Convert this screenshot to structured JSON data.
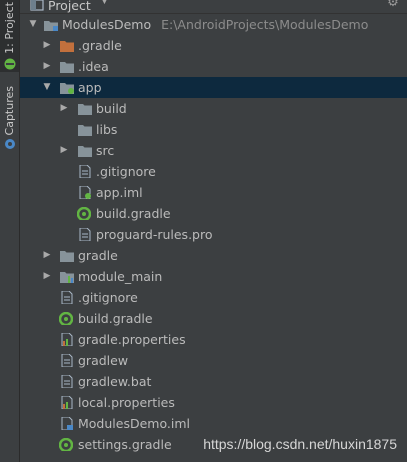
{
  "sidebar": {
    "project_tab": "1: Project",
    "captures_tab": "Captures"
  },
  "header": {
    "title": "Project"
  },
  "tree": {
    "root_name": "ModulesDemo",
    "root_path": "E:\\AndroidProjects\\ModulesDemo",
    "items": [
      {
        "label": ".gradle"
      },
      {
        "label": ".idea"
      },
      {
        "label": "app"
      },
      {
        "label": "build"
      },
      {
        "label": "libs"
      },
      {
        "label": "src"
      },
      {
        "label": ".gitignore"
      },
      {
        "label": "app.iml"
      },
      {
        "label": "build.gradle"
      },
      {
        "label": "proguard-rules.pro"
      },
      {
        "label": "gradle"
      },
      {
        "label": "module_main"
      },
      {
        "label": ".gitignore"
      },
      {
        "label": "build.gradle"
      },
      {
        "label": "gradle.properties"
      },
      {
        "label": "gradlew"
      },
      {
        "label": "gradlew.bat"
      },
      {
        "label": "local.properties"
      },
      {
        "label": "ModulesDemo.iml"
      },
      {
        "label": "settings.gradle"
      }
    ]
  },
  "watermark": "https://blog.csdn.net/huxin1875",
  "colors": {
    "background": "#3c3f41",
    "selection": "#0d293e",
    "folder": "#87939a",
    "gradle_folder": "#c2703d",
    "gradle_green": "#62b543"
  }
}
